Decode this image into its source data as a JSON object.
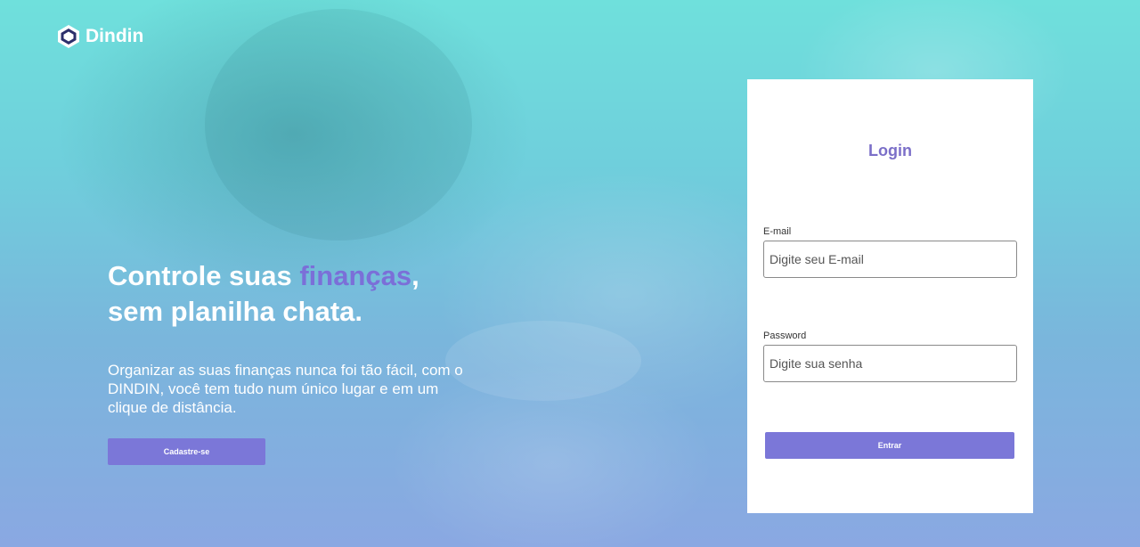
{
  "brand": {
    "name": "Dindin",
    "color": "#7b77d8"
  },
  "hero": {
    "title_part1": "Controle suas ",
    "title_highlight": "finanças",
    "title_part2": ",",
    "title_line2": "sem planilha chata.",
    "description": "Organizar as suas finanças nunca foi tão fácil, com o DINDIN, você tem tudo num único lugar e em um clique de distância.",
    "signup_label": "Cadastre-se"
  },
  "login": {
    "title": "Login",
    "email_label": "E-mail",
    "email_placeholder": "Digite seu E-mail",
    "email_value": "",
    "password_label": "Password",
    "password_placeholder": "Digite sua senha",
    "password_value": "",
    "submit_label": "Entrar"
  },
  "colors": {
    "accent": "#7b77d8",
    "title": "#7b6fc8",
    "bg_top": "#6fe0dc",
    "bg_bottom": "#8aa8e2"
  },
  "icons": {
    "logo": "hexagon-logo-icon"
  }
}
